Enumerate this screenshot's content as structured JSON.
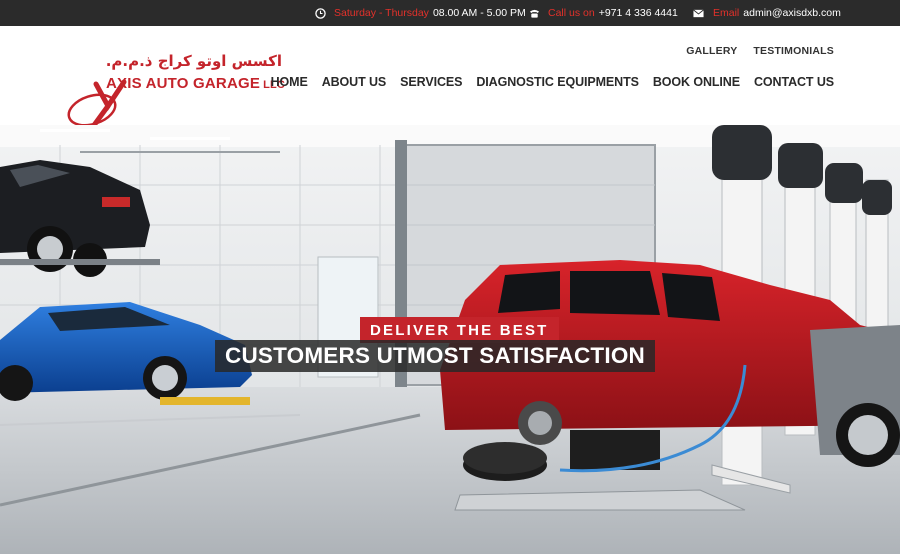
{
  "topbar": {
    "hours_label": "Saturday - Thursday",
    "hours_value": "08.00 AM - 5.00 PM",
    "phone_label": "Call us on",
    "phone_value": "+971 4 336 4441",
    "email_label": "Email",
    "email_value": "admin@axisdxb.com",
    "icons": [
      "clock-icon",
      "phone-icon",
      "mail-icon"
    ]
  },
  "logo": {
    "arabic": "اكسس اوتو كراج ذ.م.م.",
    "name": "AXIS AUTO GARAGE",
    "suffix": "LLC"
  },
  "secondary_nav": [
    "GALLERY",
    "TESTIMONIALS"
  ],
  "main_nav": [
    "HOME",
    "ABOUT US",
    "SERVICES",
    "DIAGNOSTIC EQUIPMENTS",
    "BOOK ONLINE",
    "CONTACT US"
  ],
  "hero": {
    "tagline": "DELIVER THE BEST",
    "headline": "CUSTOMERS UTMOST SATISFACTION"
  },
  "colors": {
    "accent": "#c4242b",
    "topbar_bg": "#2b2b2b",
    "label_red": "#e2312b"
  }
}
